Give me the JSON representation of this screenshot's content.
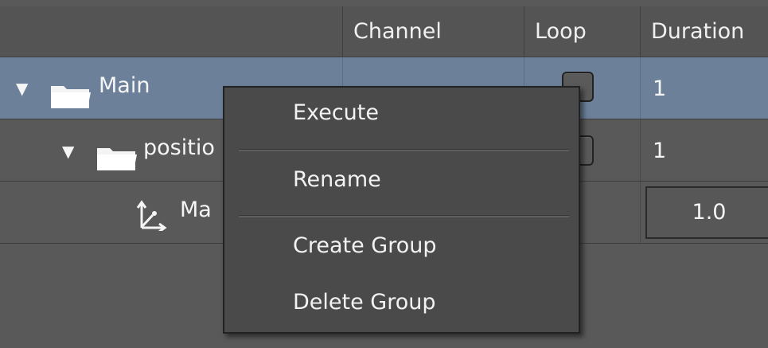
{
  "header": {
    "columns": [
      "",
      "Channel",
      "Loop",
      "Duration"
    ]
  },
  "rows": [
    {
      "name": "Main",
      "loop": true,
      "duration": "1",
      "expanded": true,
      "icon": "folder-icon"
    },
    {
      "name": "positio",
      "loop": true,
      "duration": "1",
      "expanded": true,
      "icon": "folder-icon"
    },
    {
      "name": "Ma",
      "duration": "1.0",
      "icon": "axes-icon"
    }
  ],
  "context_menu": {
    "items": [
      "Execute",
      "Rename",
      "Create Group",
      "Delete Group"
    ]
  },
  "colors": {
    "selected_row": "#6c8099",
    "background": "#595959",
    "menu_bg": "#4a4a4a"
  }
}
